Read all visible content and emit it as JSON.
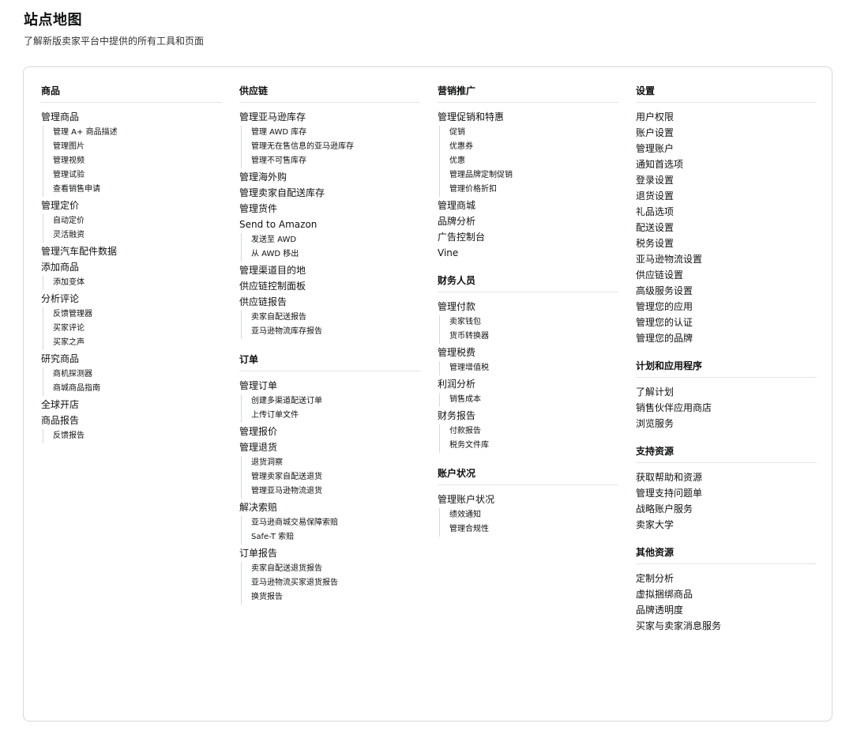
{
  "page": {
    "title": "站点地图",
    "subtitle": "了解新版卖家平台中提供的所有工具和页面"
  },
  "columns": [
    [
      {
        "title": "商品",
        "items": [
          {
            "label": "管理商品",
            "subs": [
              "管理 A+ 商品描述",
              "管理图片",
              "管理视频",
              "管理试验",
              "查看销售申请"
            ]
          },
          {
            "label": "管理定价",
            "subs": [
              "自动定价",
              "灵活融资"
            ]
          },
          {
            "label": "管理汽车配件数据",
            "subs": []
          },
          {
            "label": "添加商品",
            "subs": [
              "添加变体"
            ]
          },
          {
            "label": "分析评论",
            "subs": [
              "反馈管理器",
              "买家评论",
              "买家之声"
            ]
          },
          {
            "label": "研究商品",
            "subs": [
              "商机探测器",
              "商城商品指南"
            ]
          },
          {
            "label": "全球开店",
            "subs": []
          },
          {
            "label": "商品报告",
            "subs": [
              "反馈报告"
            ]
          }
        ]
      }
    ],
    [
      {
        "title": "供应链",
        "items": [
          {
            "label": "管理亚马逊库存",
            "subs": [
              "管理 AWD 库存",
              "管理无在售信息的亚马逊库存",
              "管理不可售库存"
            ]
          },
          {
            "label": "管理海外购",
            "subs": []
          },
          {
            "label": "管理卖家自配送库存",
            "subs": []
          },
          {
            "label": "管理货件",
            "subs": []
          },
          {
            "label": "Send to Amazon",
            "subs": [
              "发送至 AWD",
              "从 AWD 移出"
            ]
          },
          {
            "label": "管理渠道目的地",
            "subs": []
          },
          {
            "label": "供应链控制面板",
            "subs": []
          },
          {
            "label": "供应链报告",
            "subs": [
              "卖家自配送报告",
              "亚马逊物流库存报告"
            ]
          }
        ]
      },
      {
        "title": "订单",
        "items": [
          {
            "label": "管理订单",
            "subs": [
              "创建多渠道配送订单",
              "上传订单文件"
            ]
          },
          {
            "label": "管理报价",
            "subs": []
          },
          {
            "label": "管理退货",
            "subs": [
              "退货洞察",
              "管理卖家自配送退货",
              "管理亚马逊物流退货"
            ]
          },
          {
            "label": "解决索赔",
            "subs": [
              "亚马逊商城交易保障索赔",
              "Safe-T 索赔"
            ]
          },
          {
            "label": "订单报告",
            "subs": [
              "卖家自配送退货报告",
              "亚马逊物流买家退货报告",
              "换货报告"
            ]
          }
        ]
      }
    ],
    [
      {
        "title": "营销推广",
        "items": [
          {
            "label": "管理促销和特惠",
            "subs": [
              "促销",
              "优惠券",
              "优惠",
              "管理品牌定制促销",
              "管理价格折扣"
            ]
          },
          {
            "label": "管理商城",
            "subs": []
          },
          {
            "label": "品牌分析",
            "subs": []
          },
          {
            "label": "广告控制台",
            "subs": []
          },
          {
            "label": "Vine",
            "subs": []
          }
        ]
      },
      {
        "title": "财务人员",
        "items": [
          {
            "label": "管理付款",
            "subs": [
              "卖家钱包",
              "货币转换器"
            ]
          },
          {
            "label": "管理税费",
            "subs": [
              "管理增值税"
            ]
          },
          {
            "label": "利润分析",
            "subs": [
              "销售成本"
            ]
          },
          {
            "label": "财务报告",
            "subs": [
              "付款报告",
              "税务文件库"
            ]
          }
        ]
      },
      {
        "title": "账户状况",
        "items": [
          {
            "label": "管理账户状况",
            "subs": [
              "绩效通知",
              "管理合规性"
            ]
          }
        ]
      }
    ],
    [
      {
        "title": "设置",
        "items": [
          {
            "label": "用户权限",
            "subs": []
          },
          {
            "label": "账户设置",
            "subs": []
          },
          {
            "label": "管理账户",
            "subs": []
          },
          {
            "label": "通知首选项",
            "subs": []
          },
          {
            "label": "登录设置",
            "subs": []
          },
          {
            "label": "退货设置",
            "subs": []
          },
          {
            "label": "礼品选项",
            "subs": []
          },
          {
            "label": "配送设置",
            "subs": []
          },
          {
            "label": "税务设置",
            "subs": []
          },
          {
            "label": "亚马逊物流设置",
            "subs": []
          },
          {
            "label": "供应链设置",
            "subs": []
          },
          {
            "label": "高级服务设置",
            "subs": []
          },
          {
            "label": "管理您的应用",
            "subs": []
          },
          {
            "label": "管理您的认证",
            "subs": []
          },
          {
            "label": "管理您的品牌",
            "subs": []
          }
        ]
      },
      {
        "title": "计划和应用程序",
        "items": [
          {
            "label": "了解计划",
            "subs": []
          },
          {
            "label": "销售伙伴应用商店",
            "subs": []
          },
          {
            "label": "浏览服务",
            "subs": []
          }
        ]
      },
      {
        "title": "支持资源",
        "items": [
          {
            "label": "获取帮助和资源",
            "subs": []
          },
          {
            "label": "管理支持问题单",
            "subs": []
          },
          {
            "label": "战略账户服务",
            "subs": []
          },
          {
            "label": "卖家大学",
            "subs": []
          }
        ]
      },
      {
        "title": "其他资源",
        "items": [
          {
            "label": "定制分析",
            "subs": []
          },
          {
            "label": "虚拟捆绑商品",
            "subs": []
          },
          {
            "label": "品牌透明度",
            "subs": []
          },
          {
            "label": "买家与卖家消息服务",
            "subs": []
          }
        ]
      }
    ]
  ]
}
